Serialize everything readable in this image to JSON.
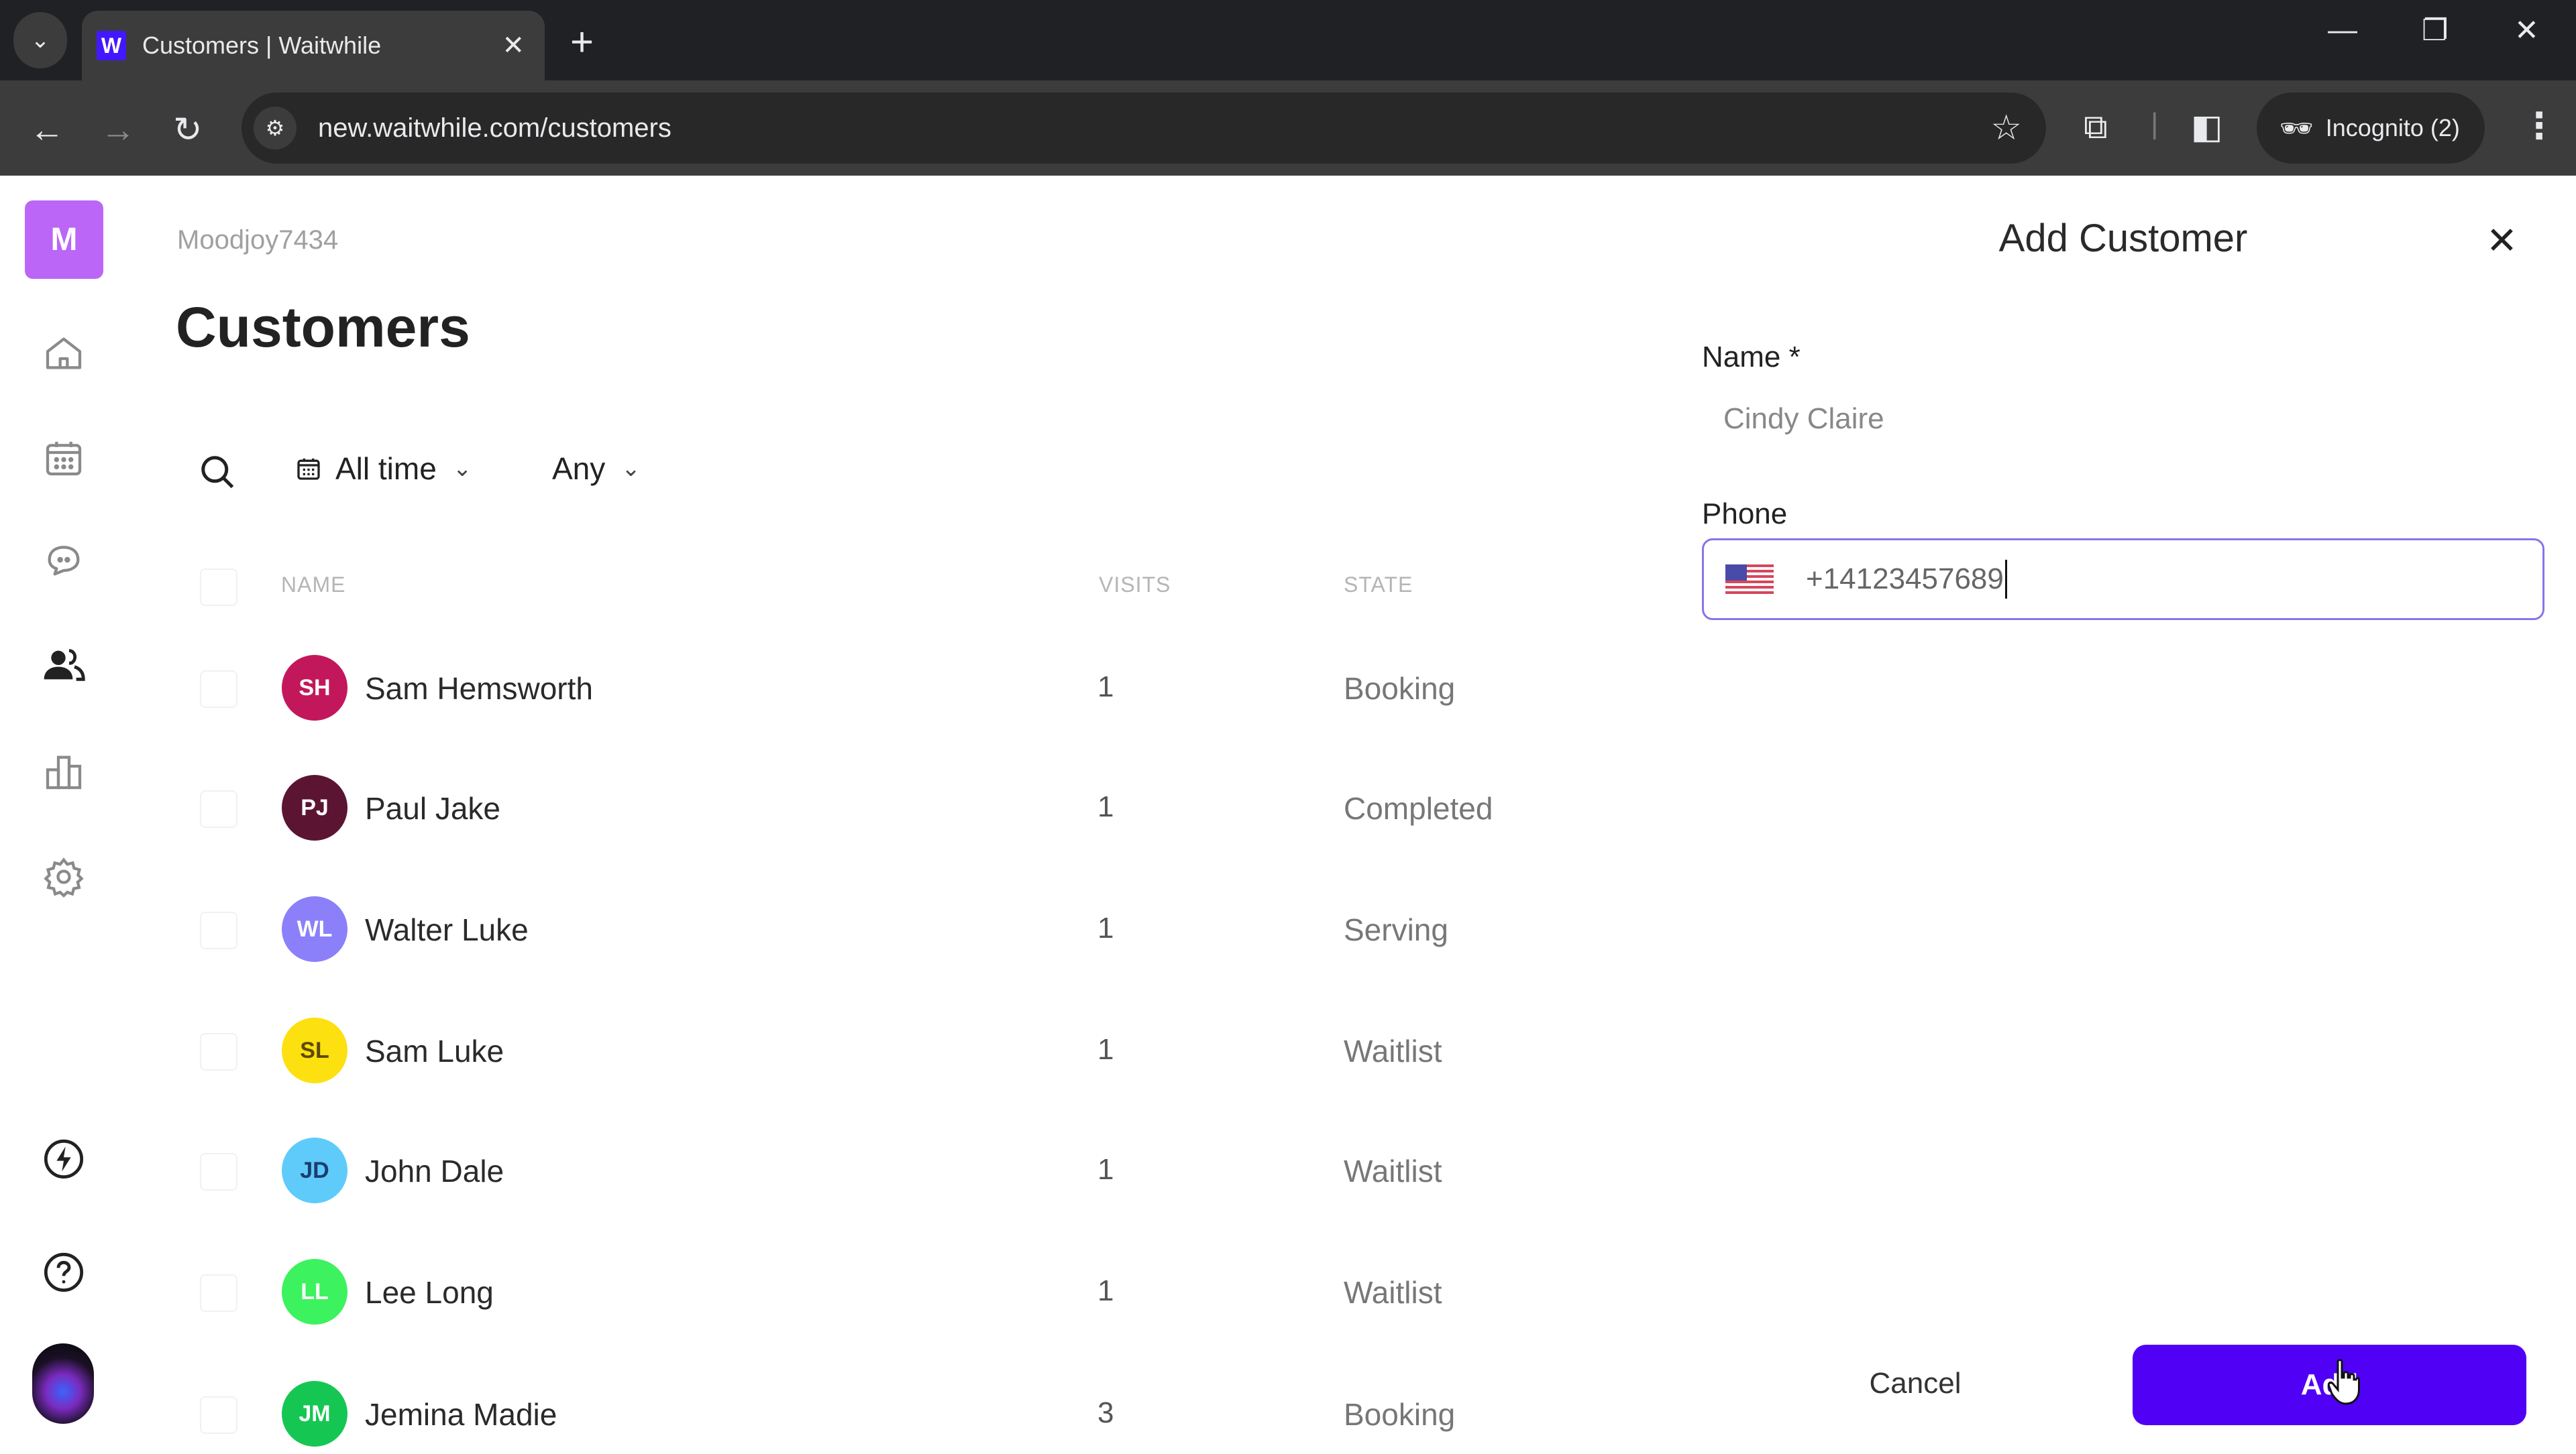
{
  "browser": {
    "tab_title": "Customers | Waitwhile",
    "favicon_letter": "W",
    "url": "new.waitwhile.com/customers",
    "incognito_label": "Incognito (2)",
    "new_tab_symbol": "+",
    "tab_close_symbol": "✕",
    "window": {
      "minimize": "—",
      "restore": "❐",
      "close": "✕"
    },
    "accent_color": "#4318ff"
  },
  "sidebar": {
    "org_initial": "M",
    "org_color": "#bb66f7",
    "items": [
      {
        "name": "home",
        "icon": "home-icon",
        "active": false
      },
      {
        "name": "calendar",
        "icon": "calendar-icon",
        "active": false
      },
      {
        "name": "messages",
        "icon": "chat-icon",
        "active": false
      },
      {
        "name": "customers",
        "icon": "customers-icon",
        "active": true
      },
      {
        "name": "analytics",
        "icon": "bar-chart-icon",
        "active": false
      },
      {
        "name": "settings",
        "icon": "gear-icon",
        "active": false
      }
    ],
    "bottom_items": [
      {
        "name": "whats-new",
        "icon": "lightning-icon"
      },
      {
        "name": "help",
        "icon": "help-icon"
      }
    ]
  },
  "main": {
    "org_name": "Moodjoy7434",
    "title": "Customers",
    "filters": {
      "date_range": "All time",
      "state": "Any"
    },
    "columns": {
      "name": "NAME",
      "visits": "VISITS",
      "state": "STATE"
    },
    "customers": [
      {
        "initials": "SH",
        "name": "Sam Hemsworth",
        "visits": "1",
        "state": "Booking",
        "color": "#c2185b",
        "text_color": "#ffffff"
      },
      {
        "initials": "PJ",
        "name": "Paul Jake",
        "visits": "1",
        "state": "Completed",
        "color": "#5c1433",
        "text_color": "#ffffff"
      },
      {
        "initials": "WL",
        "name": "Walter Luke",
        "visits": "1",
        "state": "Serving",
        "color": "#8b80f9",
        "text_color": "#ffffff"
      },
      {
        "initials": "SL",
        "name": "Sam Luke",
        "visits": "1",
        "state": "Waitlist",
        "color": "#fde00f",
        "text_color": "#5a4a00"
      },
      {
        "initials": "JD",
        "name": "John Dale",
        "visits": "1",
        "state": "Waitlist",
        "color": "#5ecbfa",
        "text_color": "#1b3d6e"
      },
      {
        "initials": "LL",
        "name": "Lee Long",
        "visits": "1",
        "state": "Waitlist",
        "color": "#3cf25e",
        "text_color": "#ffffff"
      },
      {
        "initials": "JM",
        "name": "Jemina Madie",
        "visits": "3",
        "state": "Booking",
        "color": "#16c653",
        "text_color": "#ffffff"
      }
    ]
  },
  "panel": {
    "title": "Add Customer",
    "name_label": "Name *",
    "name_value": "Cindy Claire",
    "phone_label": "Phone",
    "phone_country": "US",
    "phone_value": "+14123457689",
    "cancel_label": "Cancel",
    "add_label": "Add",
    "primary_color": "#5000f5"
  }
}
